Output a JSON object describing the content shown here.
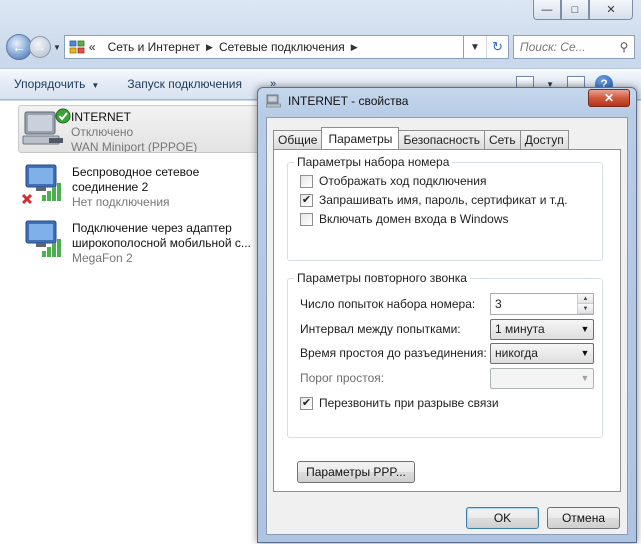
{
  "explorer": {
    "breadcrumb": [
      "Сеть и Интернет",
      "Сетевые подключения"
    ],
    "chevrons": "«",
    "search_placeholder": "Поиск: Се...",
    "toolbar": {
      "organize": "Упорядочить",
      "start_connection": "Запуск подключения",
      "more": "»"
    },
    "connections": [
      {
        "name": "INTERNET",
        "status": "Отключено",
        "device": "WAN Miniport (PPPOE)"
      },
      {
        "name": "Беспроводное сетевое",
        "name2": "соединение 2",
        "status": "Нет подключения"
      },
      {
        "name": "Подключение через адаптер",
        "name2": "широкополосной мобильной с...",
        "status": "MegaFon  2"
      }
    ]
  },
  "dialog": {
    "title": "INTERNET - свойства",
    "tabs": [
      "Общие",
      "Параметры",
      "Безопасность",
      "Сеть",
      "Доступ"
    ],
    "active_tab": "Параметры",
    "dialing_group": {
      "title": "Параметры набора номера",
      "options": [
        {
          "label": "Отображать ход подключения",
          "checked": false
        },
        {
          "label": "Запрашивать имя, пароль, сертификат и т.д.",
          "checked": true
        },
        {
          "label": "Включать домен входа в Windows",
          "checked": false
        }
      ]
    },
    "redial_group": {
      "title": "Параметры повторного звонка",
      "attempts_label": "Число попыток набора номера:",
      "attempts_value": "3",
      "interval_label": "Интервал между попытками:",
      "interval_value": "1 минута",
      "idle_label": "Время простоя до разъединения:",
      "idle_value": "никогда",
      "idle_threshold_label": "Порог простоя:",
      "idle_threshold_value": "",
      "redial_label": "Перезвонить при разрыве связи",
      "redial_checked": true
    },
    "ppp_button": "Параметры PPP...",
    "ok_button": "OK",
    "cancel_button": "Отмена"
  }
}
